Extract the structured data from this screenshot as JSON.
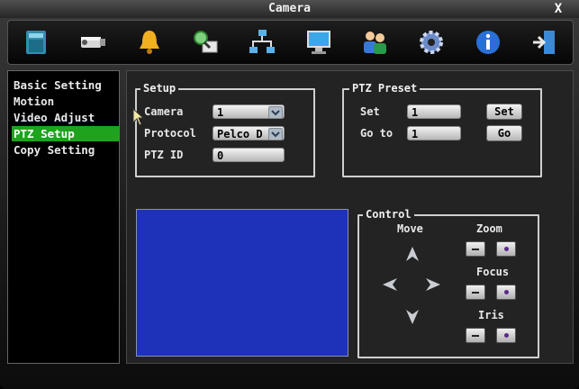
{
  "window": {
    "title": "Camera",
    "close_label": "X"
  },
  "toolbar": {
    "icons": [
      "system-icon",
      "camera-icon",
      "alarm-bell-icon",
      "search-icon",
      "network-icon",
      "display-icon",
      "users-icon",
      "gear-icon",
      "info-icon",
      "exit-icon"
    ]
  },
  "sidebar": {
    "items": [
      {
        "label": "Basic Setting",
        "selected": false
      },
      {
        "label": "Motion",
        "selected": false
      },
      {
        "label": "Video Adjust",
        "selected": false
      },
      {
        "label": "PTZ Setup",
        "selected": true
      },
      {
        "label": "Copy Setting",
        "selected": false
      }
    ]
  },
  "setup": {
    "title": "Setup",
    "camera_label": "Camera",
    "camera_value": "1",
    "protocol_label": "Protocol",
    "protocol_value": "Pelco D",
    "ptz_id_label": "PTZ ID",
    "ptz_id_value": "0"
  },
  "preset": {
    "title": "PTZ Preset",
    "set_label": "Set",
    "set_value": "1",
    "set_button": "Set",
    "goto_label": "Go to",
    "goto_value": "1",
    "goto_button": "Go"
  },
  "control": {
    "title": "Control",
    "move_label": "Move",
    "zoom_label": "Zoom",
    "focus_label": "Focus",
    "iris_label": "Iris"
  },
  "colors": {
    "selected_menu": "#1fa31f",
    "preview_blue": "#1d32b8"
  }
}
